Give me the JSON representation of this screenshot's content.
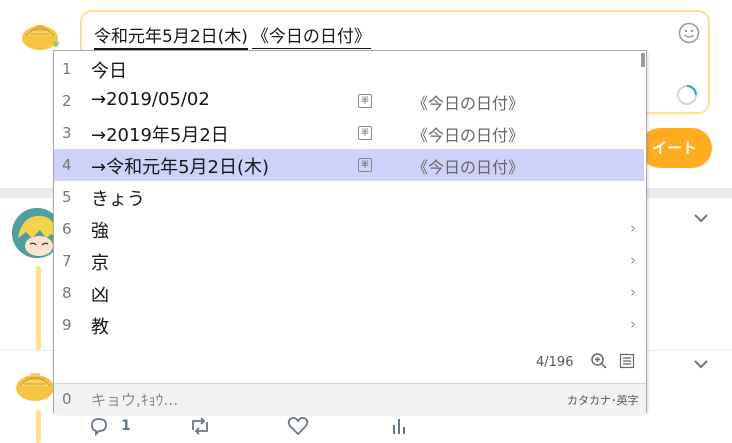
{
  "compose": {
    "text_part1": "令和元年5月2日(木)",
    "text_part2": "《今日の日付》"
  },
  "tweet_button": {
    "label": "イート"
  },
  "ime": {
    "candidates": [
      {
        "num": "1",
        "text": "今日",
        "note": "",
        "has_fn": false,
        "has_submenu": false,
        "selected": false
      },
      {
        "num": "2",
        "text": "→2019/05/02",
        "note": "《今日の日付》",
        "has_fn": true,
        "has_submenu": false,
        "selected": false
      },
      {
        "num": "3",
        "text": "→2019年5月2日",
        "note": "《今日の日付》",
        "has_fn": true,
        "has_submenu": false,
        "selected": false
      },
      {
        "num": "4",
        "text": "→令和元年5月2日(木)",
        "note": "《今日の日付》",
        "has_fn": true,
        "has_submenu": false,
        "selected": true
      },
      {
        "num": "5",
        "text": "きょう",
        "note": "",
        "has_fn": false,
        "has_submenu": false,
        "selected": false
      },
      {
        "num": "6",
        "text": "強",
        "note": "",
        "has_fn": false,
        "has_submenu": true,
        "selected": false
      },
      {
        "num": "7",
        "text": "京",
        "note": "",
        "has_fn": false,
        "has_submenu": true,
        "selected": false
      },
      {
        "num": "8",
        "text": "凶",
        "note": "",
        "has_fn": false,
        "has_submenu": true,
        "selected": false
      },
      {
        "num": "9",
        "text": "教",
        "note": "",
        "has_fn": false,
        "has_submenu": true,
        "selected": false
      }
    ],
    "fn_glyph": "半",
    "count": "4/196",
    "footer": {
      "num": "0",
      "reading": "キョウ,ｷｮｳ…",
      "mode": "カタカナ･英字"
    }
  },
  "tweet_actions": {
    "reply_count": "1"
  },
  "colors": {
    "accent": "#ffad1f",
    "compose_border": "#ffe08a",
    "selection": "#cfd2f8",
    "thread_line": "#ffe08a"
  },
  "icons": [
    "emoji-icon",
    "progress-ring-icon",
    "chevron-down-icon",
    "reply-icon",
    "retweet-icon",
    "like-icon",
    "analytics-icon",
    "zoom-in-icon",
    "list-icon",
    "chevron-right-icon"
  ]
}
